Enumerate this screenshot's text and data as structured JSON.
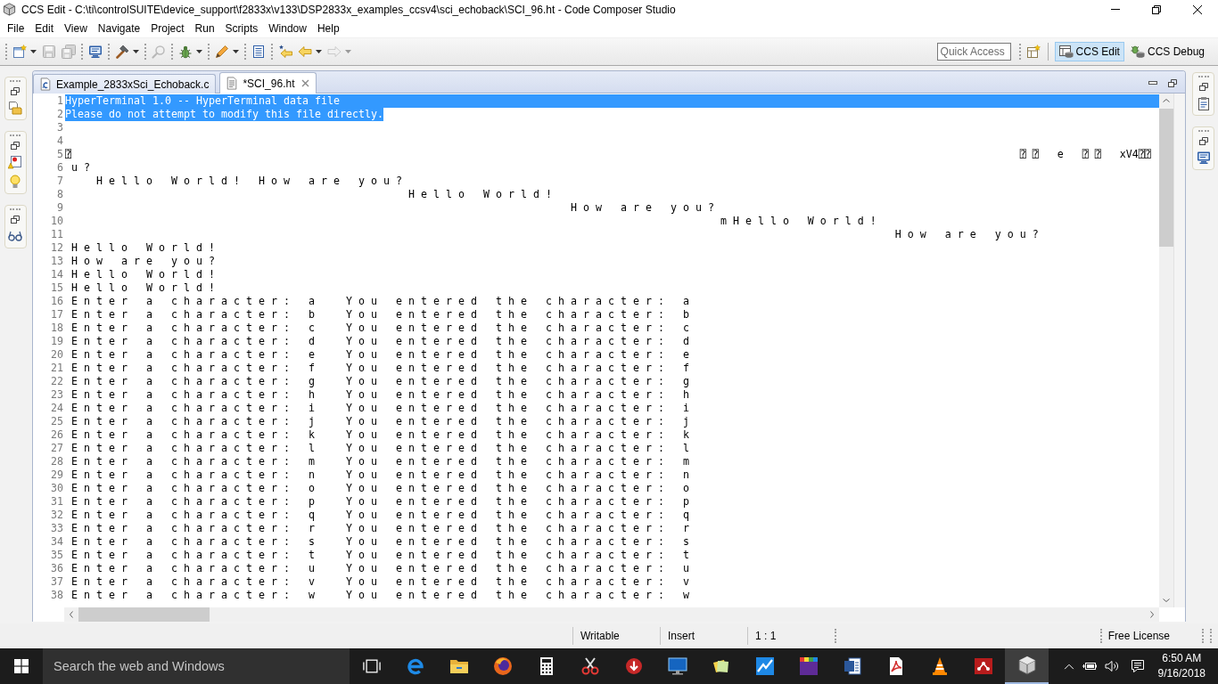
{
  "window": {
    "title": "CCS Edit - C:\\ti\\controlSUITE\\device_support\\f2833x\\v133\\DSP2833x_examples_ccsv4\\sci_echoback\\SCI_96.ht - Code Composer Studio"
  },
  "menu": [
    "File",
    "Edit",
    "View",
    "Navigate",
    "Project",
    "Run",
    "Scripts",
    "Window",
    "Help"
  ],
  "toolbar": {
    "groups": [
      {
        "items": [
          {
            "disabled": false,
            "dropdown": true
          },
          {
            "disabled": true
          },
          {
            "disabled": true
          }
        ]
      },
      {
        "items": [
          {
            "disabled": false
          }
        ]
      },
      {
        "items": [
          {
            "disabled": false,
            "dropdown": true
          }
        ]
      },
      {
        "items": [
          {
            "disabled": true
          }
        ]
      },
      {
        "items": [
          {
            "disabled": false,
            "dropdown": true
          }
        ]
      },
      {
        "items": [
          {
            "disabled": false,
            "dropdown": true
          }
        ]
      },
      {
        "items": [
          {
            "disabled": false
          }
        ]
      },
      {
        "items": [
          {
            "disabled": false
          },
          {
            "disabled": false,
            "dropdown": true
          },
          {
            "disabled": true,
            "dropdown": true
          }
        ]
      }
    ]
  },
  "quick_access": {
    "placeholder": "Quick Access"
  },
  "perspectives": [
    {
      "label": "CCS Edit",
      "selected": true
    },
    {
      "label": "CCS Debug",
      "selected": false
    }
  ],
  "editor": {
    "tabs": [
      {
        "label": "Example_2833xSci_Echoback.c",
        "kind": "c_file",
        "selected": false
      },
      {
        "label": "*SCI_96.ht",
        "kind": "text_file",
        "selected": true
      }
    ],
    "lines": [
      {
        "number": "1",
        "text": "HyperTerminal 1.0 -- HyperTerminal data file",
        "selected": true
      },
      {
        "number": "2",
        "text": "Please do not attempt to modify this file directly.",
        "selected": true
      },
      {
        "number": "3",
        "selected": false
      },
      {
        "number": "4",
        "selected": false
      },
      {
        "number": "5",
        "text": "⍰                                                                                                                                                        ⍰ ⍰   e   ⍰ ⍰   xV4⍰⍰",
        "selected": false
      },
      {
        "number": "6",
        "text": " u ?",
        "selected": false
      },
      {
        "number": "7",
        "text": "     H e l l o   W o r l d !   H o w   a r e   y o u ?",
        "selected": false
      },
      {
        "number": "8",
        "text": "                                                       H e l l o   W o r l d !",
        "selected": false
      },
      {
        "number": "9",
        "text": "                                                                                 H o w   a r e   y o u ?",
        "selected": false
      },
      {
        "number": "10",
        "text": "                                                                                                         m H e l l o   W o r l d !",
        "selected": false
      },
      {
        "number": "11",
        "text": "                                                                                                                                     H o w   a r e   y o u ?",
        "selected": false
      },
      {
        "number": "12",
        "text": " H e l l o   W o r l d !",
        "selected": false
      },
      {
        "number": "13",
        "text": " H o w   a r e   y o u ?",
        "selected": false
      },
      {
        "number": "14",
        "text": " H e l l o   W o r l d !",
        "selected": false
      },
      {
        "number": "15",
        "text": " H e l l o   W o r l d !",
        "selected": false
      },
      {
        "number": "16",
        "text": " E n t e r   a   c h a r a c t e r :   a     Y o u   e n t e r e d   t h e   c h a r a c t e r :   a",
        "selected": false
      },
      {
        "number": "17",
        "text": " E n t e r   a   c h a r a c t e r :   b     Y o u   e n t e r e d   t h e   c h a r a c t e r :   b",
        "selected": false
      },
      {
        "number": "18",
        "text": " E n t e r   a   c h a r a c t e r :   c     Y o u   e n t e r e d   t h e   c h a r a c t e r :   c",
        "selected": false
      },
      {
        "number": "19",
        "text": " E n t e r   a   c h a r a c t e r :   d     Y o u   e n t e r e d   t h e   c h a r a c t e r :   d",
        "selected": false
      },
      {
        "number": "20",
        "text": " E n t e r   a   c h a r a c t e r :   e     Y o u   e n t e r e d   t h e   c h a r a c t e r :   e",
        "selected": false
      },
      {
        "number": "21",
        "text": " E n t e r   a   c h a r a c t e r :   f     Y o u   e n t e r e d   t h e   c h a r a c t e r :   f",
        "selected": false
      },
      {
        "number": "22",
        "text": " E n t e r   a   c h a r a c t e r :   g     Y o u   e n t e r e d   t h e   c h a r a c t e r :   g",
        "selected": false
      },
      {
        "number": "23",
        "text": " E n t e r   a   c h a r a c t e r :   h     Y o u   e n t e r e d   t h e   c h a r a c t e r :   h",
        "selected": false
      },
      {
        "number": "24",
        "text": " E n t e r   a   c h a r a c t e r :   i     Y o u   e n t e r e d   t h e   c h a r a c t e r :   i",
        "selected": false
      },
      {
        "number": "25",
        "text": " E n t e r   a   c h a r a c t e r :   j     Y o u   e n t e r e d   t h e   c h a r a c t e r :   j",
        "selected": false
      },
      {
        "number": "26",
        "text": " E n t e r   a   c h a r a c t e r :   k     Y o u   e n t e r e d   t h e   c h a r a c t e r :   k",
        "selected": false
      },
      {
        "number": "27",
        "text": " E n t e r   a   c h a r a c t e r :   l     Y o u   e n t e r e d   t h e   c h a r a c t e r :   l",
        "selected": false
      },
      {
        "number": "28",
        "text": " E n t e r   a   c h a r a c t e r :   m     Y o u   e n t e r e d   t h e   c h a r a c t e r :   m",
        "selected": false
      },
      {
        "number": "29",
        "text": " E n t e r   a   c h a r a c t e r :   n     Y o u   e n t e r e d   t h e   c h a r a c t e r :   n",
        "selected": false
      },
      {
        "number": "30",
        "text": " E n t e r   a   c h a r a c t e r :   o     Y o u   e n t e r e d   t h e   c h a r a c t e r :   o",
        "selected": false
      },
      {
        "number": "31",
        "text": " E n t e r   a   c h a r a c t e r :   p     Y o u   e n t e r e d   t h e   c h a r a c t e r :   p",
        "selected": false
      },
      {
        "number": "32",
        "text": " E n t e r   a   c h a r a c t e r :   q     Y o u   e n t e r e d   t h e   c h a r a c t e r :   q",
        "selected": false
      },
      {
        "number": "33",
        "text": " E n t e r   a   c h a r a c t e r :   r     Y o u   e n t e r e d   t h e   c h a r a c t e r :   r",
        "selected": false
      },
      {
        "number": "34",
        "text": " E n t e r   a   c h a r a c t e r :   s     Y o u   e n t e r e d   t h e   c h a r a c t e r :   s",
        "selected": false
      },
      {
        "number": "35",
        "text": " E n t e r   a   c h a r a c t e r :   t     Y o u   e n t e r e d   t h e   c h a r a c t e r :   t",
        "selected": false
      },
      {
        "number": "36",
        "text": " E n t e r   a   c h a r a c t e r :   u     Y o u   e n t e r e d   t h e   c h a r a c t e r :   u",
        "selected": false
      },
      {
        "number": "37",
        "text": " E n t e r   a   c h a r a c t e r :   v     Y o u   e n t e r e d   t h e   c h a r a c t e r :   v",
        "selected": false
      },
      {
        "number": "38",
        "text": " E n t e r   a   c h a r a c t e r :   w     Y o u   e n t e r e d   t h e   c h a r a c t e r :   w",
        "selected": false
      }
    ]
  },
  "status_bar": [
    "Writable",
    "Insert",
    "1 : 1",
    "Free License"
  ],
  "taskbar": {
    "search": {
      "placeholder": "Search the web and Windows"
    },
    "apps": [
      {
        "selected": false
      },
      {
        "selected": false
      },
      {
        "selected": false
      },
      {
        "selected": false
      },
      {
        "selected": false
      },
      {
        "selected": false
      },
      {
        "selected": false
      },
      {
        "selected": false
      },
      {
        "selected": false
      },
      {
        "selected": false
      },
      {
        "selected": false
      },
      {
        "selected": false
      },
      {
        "selected": false
      },
      {
        "selected": false
      },
      {
        "selected": true
      }
    ],
    "clock": {
      "time": "6:50 AM",
      "date": "9/16/2018"
    }
  }
}
